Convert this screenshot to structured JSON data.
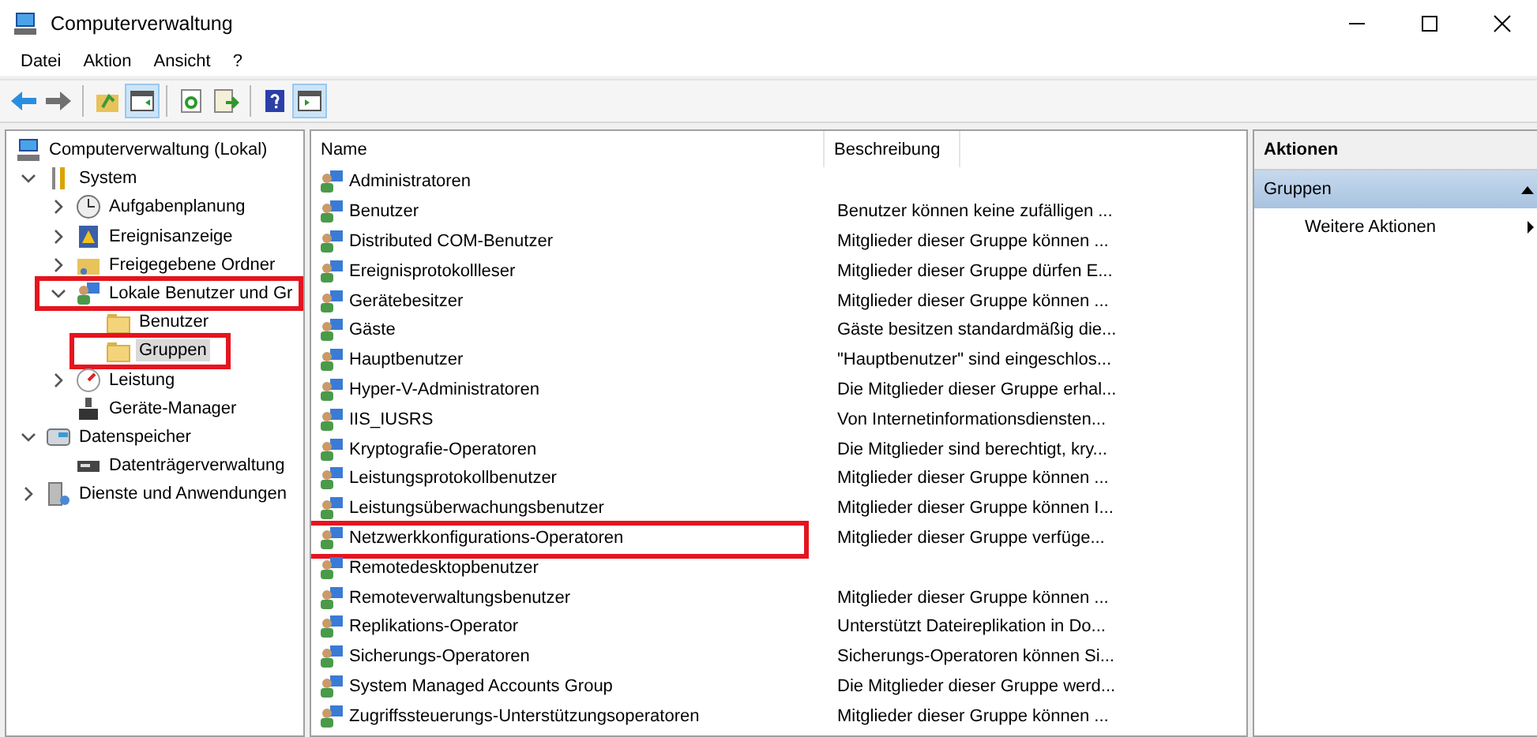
{
  "window": {
    "title": "Computerverwaltung"
  },
  "menu": [
    "Datei",
    "Aktion",
    "Ansicht",
    "?"
  ],
  "toolbar": [
    {
      "kind": "back",
      "pressed": false
    },
    {
      "kind": "forward",
      "pressed": false
    },
    {
      "kind": "sep"
    },
    {
      "kind": "up",
      "pressed": false
    },
    {
      "kind": "tree",
      "pressed": true
    },
    {
      "kind": "sep"
    },
    {
      "kind": "refresh",
      "pressed": false
    },
    {
      "kind": "export",
      "pressed": false
    },
    {
      "kind": "sep"
    },
    {
      "kind": "help",
      "pressed": false
    },
    {
      "kind": "panel",
      "pressed": true
    }
  ],
  "tree": [
    {
      "label": "Computerverwaltung (Lokal)",
      "kind": "computer",
      "selected": false,
      "children": [
        {
          "label": "System",
          "kind": "tools",
          "expanded": true,
          "selected": false,
          "children": [
            {
              "label": "Aufgabenplanung",
              "kind": "clock",
              "expanded": false,
              "selected": false
            },
            {
              "label": "Ereignisanzeige",
              "kind": "log",
              "expanded": false,
              "selected": false
            },
            {
              "label": "Freigegebene Ordner",
              "kind": "share",
              "expanded": false,
              "selected": false
            },
            {
              "label": "Lokale Benutzer und Gr",
              "kind": "users",
              "expanded": true,
              "selected": false,
              "annotated": true,
              "children": [
                {
                  "label": "Benutzer",
                  "kind": "folder",
                  "selected": false
                },
                {
                  "label": "Gruppen",
                  "kind": "folder",
                  "selected": true,
                  "annotated": true
                }
              ]
            },
            {
              "label": "Leistung",
              "kind": "gauge",
              "expanded": false,
              "selected": false
            },
            {
              "label": "Geräte-Manager",
              "kind": "device",
              "selected": false
            }
          ]
        },
        {
          "label": "Datenspeicher",
          "kind": "storage",
          "expanded": true,
          "selected": false,
          "children": [
            {
              "label": "Datenträgerverwaltung",
              "kind": "disk",
              "selected": false
            }
          ]
        },
        {
          "label": "Dienste und Anwendungen",
          "kind": "services",
          "expanded": false,
          "selected": false
        }
      ]
    }
  ],
  "table": {
    "columns": [
      "Name",
      "Beschreibung"
    ],
    "rows": [
      {
        "name": "Administratoren"
      },
      {
        "name": "Benutzer",
        "description": "Benutzer können keine zufälligen ..."
      },
      {
        "name": "Distributed COM-Benutzer",
        "description": "Mitglieder dieser Gruppe können ..."
      },
      {
        "name": "Ereignisprotokollleser",
        "description": "Mitglieder dieser Gruppe dürfen E..."
      },
      {
        "name": "Gerätebesitzer",
        "description": "Mitglieder dieser Gruppe können ..."
      },
      {
        "name": "Gäste",
        "description": "Gäste besitzen standardmäßig die..."
      },
      {
        "name": "Hauptbenutzer",
        "description": "\"Hauptbenutzer\" sind eingeschlos..."
      },
      {
        "name": "Hyper-V-Administratoren",
        "description": "Die Mitglieder dieser Gruppe erhal..."
      },
      {
        "name": "IIS_IUSRS",
        "description": "Von Internetinformationsdiensten..."
      },
      {
        "name": "Kryptografie-Operatoren",
        "description": "Die Mitglieder sind berechtigt, kry..."
      },
      {
        "name": "Leistungsprotokollbenutzer",
        "description": "Mitglieder dieser Gruppe können ..."
      },
      {
        "name": "Leistungsüberwachungsbenutzer",
        "description": "Mitglieder dieser Gruppe können I..."
      },
      {
        "name": "Netzwerkkonfigurations-Operatoren",
        "description": "Mitglieder dieser Gruppe verfüge...",
        "annotated": true
      },
      {
        "name": "Remotedesktopbenutzer"
      },
      {
        "name": "Remoteverwaltungsbenutzer",
        "description": "Mitglieder dieser Gruppe können ..."
      },
      {
        "name": "Replikations-Operator",
        "description": "Unterstützt Dateireplikation in Do..."
      },
      {
        "name": "Sicherungs-Operatoren",
        "description": "Sicherungs-Operatoren können Si..."
      },
      {
        "name": "System Managed Accounts Group",
        "description": "Die Mitglieder dieser Gruppe werd..."
      },
      {
        "name": "Zugriffssteuerungs-Unterstützungsoperatoren",
        "description": "Mitglieder dieser Gruppe können ..."
      }
    ]
  },
  "actions": {
    "title": "Aktionen",
    "section": "Gruppen",
    "items": [
      "Weitere Aktionen"
    ]
  }
}
